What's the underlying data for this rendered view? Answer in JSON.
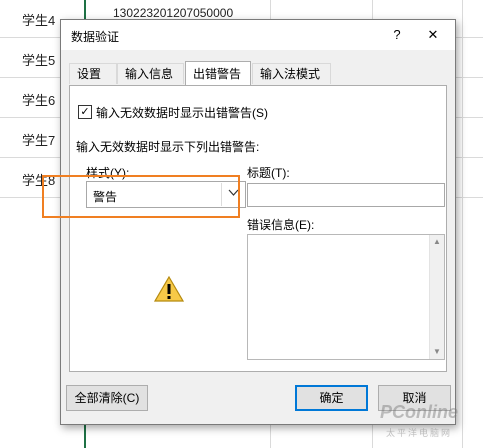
{
  "sheet": {
    "rows": [
      "学生4",
      "学生5",
      "学生6",
      "学生7",
      "学生8"
    ],
    "cell_value": "130223201207050000"
  },
  "dialog": {
    "title": "数据验证",
    "help": "?",
    "close": "✕",
    "tabs": [
      "设置",
      "输入信息",
      "出错警告",
      "输入法模式"
    ],
    "active_tab": "出错警告",
    "show_alert_label": "输入无效数据时显示出错警告(S)",
    "show_alert_checked": true,
    "section_label": "输入无效数据时显示下列出错警告:",
    "style_label": "样式(Y):",
    "style_value": "警告",
    "title_label": "标题(T):",
    "title_value": "",
    "error_label": "错误信息(E):",
    "error_value": "",
    "clear_all": "全部清除(C)",
    "ok": "确定",
    "cancel": "取消",
    "warning_icon": "warning-triangle-icon",
    "colors": {
      "highlight": "#f07f22",
      "accent": "#0078d7",
      "gridline_green": "#1e7145"
    }
  },
  "watermark": {
    "brand": "PConline",
    "sub": "太平洋电脑网"
  }
}
